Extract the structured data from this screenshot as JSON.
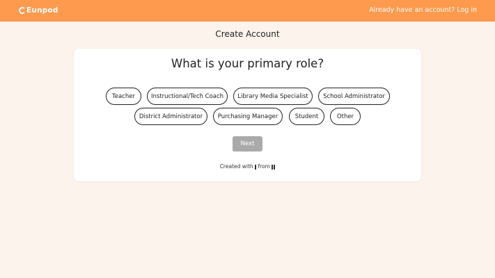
{
  "header": {
    "brand": "Eunpod",
    "login_prompt": "Already have an account? Log in"
  },
  "page": {
    "title": "Create Account"
  },
  "form": {
    "question": "What is your primary role?",
    "roles": [
      "Teacher",
      "Instructional/Tech Coach",
      "Library Media Specialist",
      "School Administrator",
      "District Administrator",
      "Purchasing Manager",
      "Student",
      "Other"
    ],
    "next_label": "Next",
    "next_enabled": false
  },
  "footer": {
    "created_with": "Created with",
    "from": "from"
  },
  "colors": {
    "header_bg": "#fd9a4d",
    "page_bg": "#fbf3ec",
    "disabled_button": "#aaaaaa"
  },
  "icons": {
    "brand": "eunpod-logo",
    "footer_tool": "bar-icon",
    "footer_maker": "double-bar-icon"
  }
}
